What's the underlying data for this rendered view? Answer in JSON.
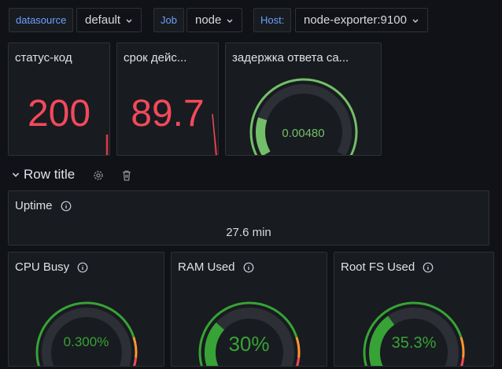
{
  "variables": [
    {
      "label": "datasource",
      "value": "default"
    },
    {
      "label": "Job",
      "value": "node"
    },
    {
      "label": "Host:",
      "value": "node-exporter:9100"
    }
  ],
  "panels": {
    "status": {
      "title": "статус-код",
      "value": "200"
    },
    "expiry": {
      "title": "срок дейс...",
      "value": "89.7"
    },
    "latency": {
      "title": "задержка ответа са...",
      "value": "0.00480",
      "fraction": 0.2
    }
  },
  "row": {
    "title": "Row title",
    "icons": [
      "chevron-down-icon",
      "gear-icon",
      "trash-icon"
    ]
  },
  "uptime": {
    "title": "Uptime",
    "value": "27.6 min"
  },
  "gauges": [
    {
      "title": "CPU Busy",
      "value": "0.300%",
      "fraction": 0.003
    },
    {
      "title": "RAM Used",
      "value": "30%",
      "fraction": 0.3
    },
    {
      "title": "Root FS Used",
      "value": "35.3%",
      "fraction": 0.353
    }
  ],
  "colors": {
    "red": "#f2495c",
    "green": "#37a336",
    "light_green": "#73bf69",
    "orange": "#ff9830",
    "label_blue": "#6e9fff"
  }
}
